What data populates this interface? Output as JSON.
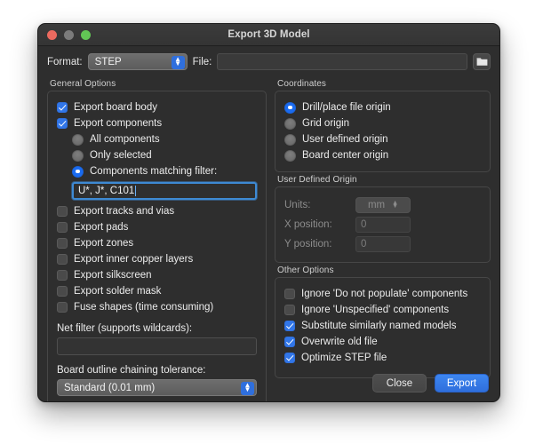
{
  "window": {
    "title": "Export 3D Model",
    "traffic_lights": [
      "close-red",
      "minimize-gray",
      "zoom-green"
    ]
  },
  "topbar": {
    "format_label": "Format:",
    "format_value": "STEP",
    "file_label": "File:",
    "file_value": "",
    "file_placeholder": "",
    "browse_icon": "folder-icon"
  },
  "general_options": {
    "title": "General Options",
    "export_board_body": {
      "label": "Export board body",
      "checked": true
    },
    "export_components": {
      "label": "Export components",
      "checked": true
    },
    "component_scope": {
      "options": [
        {
          "label": "All components",
          "selected": false
        },
        {
          "label": "Only selected",
          "selected": false
        },
        {
          "label": "Components matching filter:",
          "selected": true
        }
      ]
    },
    "filter_value": "U*, J*, C101",
    "checkboxes": [
      {
        "label": "Export tracks and vias",
        "checked": false
      },
      {
        "label": "Export pads",
        "checked": false
      },
      {
        "label": "Export zones",
        "checked": false
      },
      {
        "label": "Export inner copper layers",
        "checked": false
      },
      {
        "label": "Export silkscreen",
        "checked": false
      },
      {
        "label": "Export solder mask",
        "checked": false
      },
      {
        "label": "Fuse shapes (time consuming)",
        "checked": false
      }
    ],
    "net_filter_label": "Net filter (supports wildcards):",
    "net_filter_value": "",
    "tolerance_label": "Board outline chaining tolerance:",
    "tolerance_value": "Standard (0.01 mm)"
  },
  "coordinates": {
    "title": "Coordinates",
    "options": [
      {
        "label": "Drill/place file origin",
        "selected": true
      },
      {
        "label": "Grid origin",
        "selected": false
      },
      {
        "label": "User defined origin",
        "selected": false
      },
      {
        "label": "Board center origin",
        "selected": false
      }
    ]
  },
  "user_defined_origin": {
    "title": "User Defined Origin",
    "units_label": "Units:",
    "units_value": "mm",
    "x_label": "X position:",
    "x_value": "0",
    "y_label": "Y position:",
    "y_value": "0",
    "disabled": true
  },
  "other_options": {
    "title": "Other Options",
    "checkboxes": [
      {
        "label": "Ignore 'Do not populate' components",
        "checked": false
      },
      {
        "label": "Ignore 'Unspecified' components",
        "checked": false
      },
      {
        "label": "Substitute similarly named models",
        "checked": true
      },
      {
        "label": "Overwrite old file",
        "checked": true
      },
      {
        "label": "Optimize STEP file",
        "checked": true
      }
    ]
  },
  "footer": {
    "close_label": "Close",
    "export_label": "Export"
  },
  "colors": {
    "accent_blue": "#3176e8",
    "window_bg": "#2e2e2e",
    "titlebar_bg": "#3b3b3b",
    "focus_ring": "#3e8ad4",
    "text": "#ececec",
    "disabled_text": "#8a8a8a",
    "page_bg": "#ffffff"
  }
}
